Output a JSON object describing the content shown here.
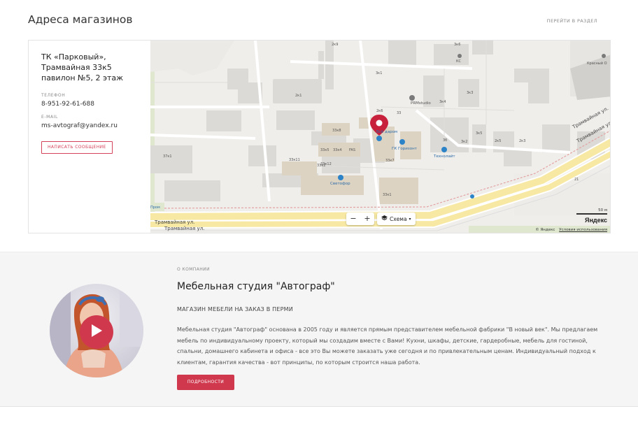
{
  "stores": {
    "title": "Адреса магазинов",
    "section_link": "ПЕРЕЙТИ В РАЗДЕЛ",
    "address_line1": "ТК «Парковый»,",
    "address_line2": "Трамвайная 33к5",
    "address_line3": "павилон №5, 2 этаж",
    "phone_label": "ТЕЛЕФОН",
    "phone": "8-951-92-61-688",
    "email_label": "E-MAIL",
    "email": "ms-avtograf@yandex.ru",
    "message_button": "НАПИСАТЬ СООБЩЕНИЕ"
  },
  "map": {
    "streets": [
      "Трамвайная ул.",
      "Трамвайная ул.",
      "Трамвайная ул.",
      "Трамвайная ул."
    ],
    "poi": [
      "Всё даром",
      "ГК Горизонт",
      "Светофор",
      "Технолайт",
      "PRMstudio"
    ],
    "building_labels": [
      "2к9",
      "3к1",
      "3к3",
      "2к1",
      "3к4",
      "33",
      "2к6",
      "33к8",
      "33к5",
      "33к4",
      "37к1",
      "33к11",
      "33к12",
      "FAS",
      "33к7",
      "33к1",
      "3к2",
      "3к5",
      "3б",
      "2к5",
      "2к3",
      "21",
      "3к6",
      "КС",
      "33к2",
      "Красный О"
    ],
    "scheme_label": "Схема",
    "zoom_in": "+",
    "zoom_out": "−",
    "scale_label": "50 м",
    "logo": "Яндекс",
    "copyright": "© Яндекс",
    "terms": "Условия использования",
    "bottom_left_label": "Пром",
    "marker_icon": "map-pin-icon",
    "marker_color": "#c8213c"
  },
  "about": {
    "kicker": "О КОМПАНИИ",
    "title": "Мебельная студия \"Автограф\"",
    "subtitle": "МАГАЗИН МЕБЕЛИ НА ЗАКАЗ В ПЕРМИ",
    "text": "Мебельная студия \"Автограф\" основана в 2005 году и является  прямым представителем мебельной фабрики \"В новый век\". Мы предлагаем мебель по индивидуальному проекту, который мы создадим вместе с Вами! Кухни, шкафы, детские, гардеробные, мебель для гостиной, спальни, домашнего кабинета и офиса - все это Вы можете заказать уже сегодня и по привлекательным ценам. Индивидуальный подход к клиентам, гарантия качества - вот принципы, по которым строится наша работа.",
    "more_button": "ПОДРОБНОСТИ",
    "accent": "#d0384e"
  }
}
